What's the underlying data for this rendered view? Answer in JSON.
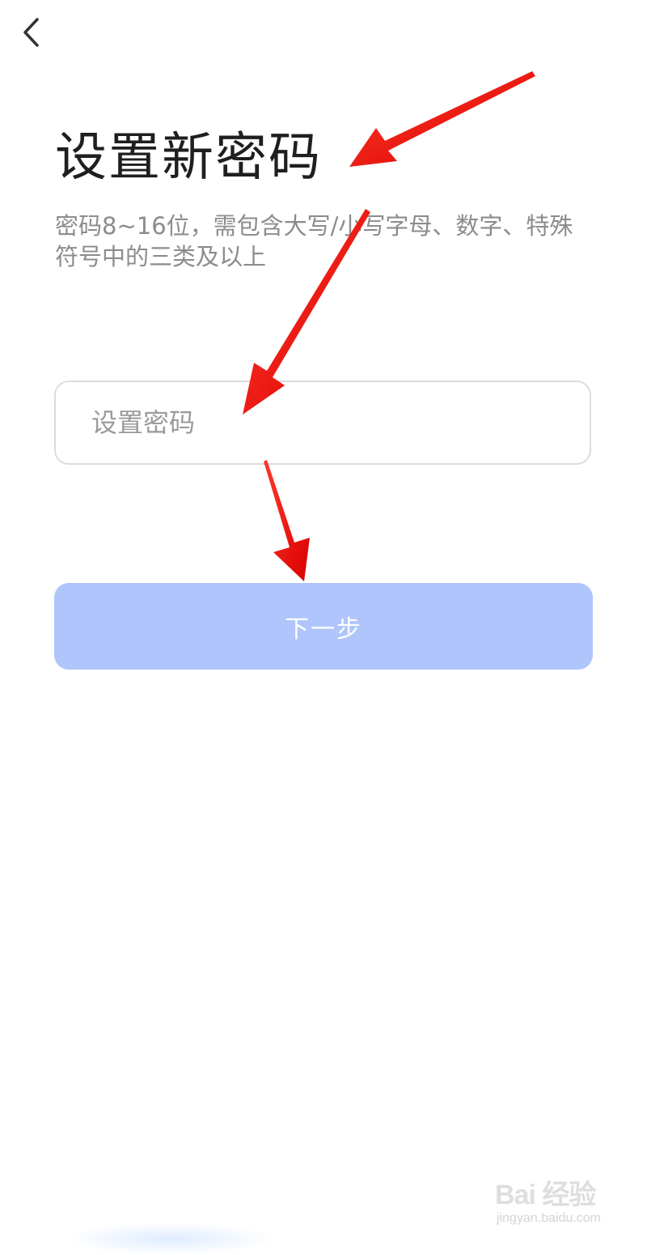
{
  "header": {
    "back_icon": "chevron-left-icon"
  },
  "page": {
    "title": "设置新密码",
    "subtitle": "密码8~16位，需包含大写/小写字母、数字、特殊符号中的三类及以上"
  },
  "form": {
    "password_placeholder": "设置密码",
    "password_value": ""
  },
  "actions": {
    "next_label": "下一步"
  },
  "watermark": {
    "logo_text": "Bai 经验",
    "url_text": "jingyan.baidu.com"
  },
  "colors": {
    "title": "#1f1f1f",
    "subtitle": "#8c8c8c",
    "input_border": "#dcdcdc",
    "button_bg": "#afc5fb",
    "button_text": "#ffffff",
    "annotation_arrow": "#ff0000"
  }
}
